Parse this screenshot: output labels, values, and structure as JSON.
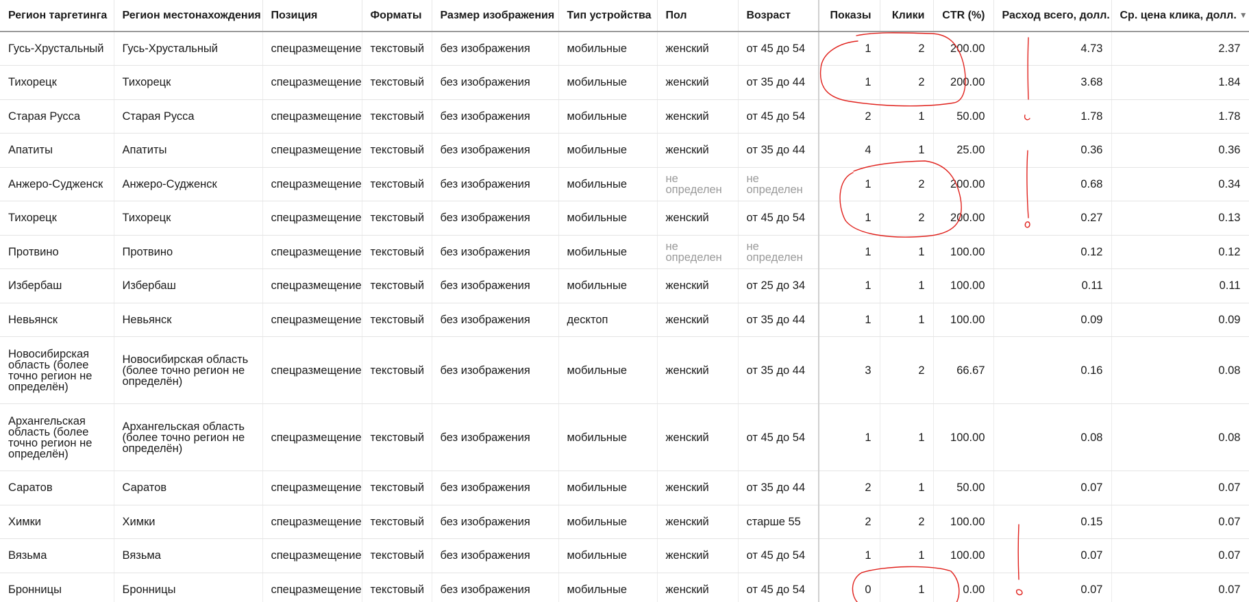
{
  "table": {
    "columns": [
      {
        "key": "target_region",
        "label": "Регион таргетинга",
        "numeric": false
      },
      {
        "key": "location_region",
        "label": "Регион местонахождения",
        "numeric": false
      },
      {
        "key": "position",
        "label": "Позиция",
        "numeric": false
      },
      {
        "key": "format",
        "label": "Форматы",
        "numeric": false
      },
      {
        "key": "image_size",
        "label": "Размер изображения",
        "numeric": false
      },
      {
        "key": "device",
        "label": "Тип устройства",
        "numeric": false
      },
      {
        "key": "gender",
        "label": "Пол",
        "numeric": false
      },
      {
        "key": "age",
        "label": "Возраст",
        "numeric": false
      },
      {
        "key": "impressions",
        "label": "Показы",
        "numeric": true
      },
      {
        "key": "clicks",
        "label": "Клики",
        "numeric": true
      },
      {
        "key": "ctr",
        "label": "CTR (%)",
        "numeric": true
      },
      {
        "key": "spend",
        "label": "Расход всего, долл.",
        "numeric": true
      },
      {
        "key": "cpc",
        "label": "Ср. цена клика, долл.",
        "numeric": true,
        "sorted": "desc",
        "sort_icon": "triangle-down-icon"
      }
    ],
    "rows": [
      {
        "target_region": "Гусь-Хрустальный",
        "location_region": "Гусь-Хрустальный",
        "position": "спецразмещение",
        "format": "текстовый",
        "image_size": "без изображения",
        "device": "мобильные",
        "gender": "женский",
        "age": "от 45 до 54",
        "impressions": "1",
        "clicks": "2",
        "ctr": "200.00",
        "spend": "4.73",
        "cpc": "2.37"
      },
      {
        "target_region": "Тихорецк",
        "location_region": "Тихорецк",
        "position": "спецразмещение",
        "format": "текстовый",
        "image_size": "без изображения",
        "device": "мобильные",
        "gender": "женский",
        "age": "от 35 до 44",
        "impressions": "1",
        "clicks": "2",
        "ctr": "200.00",
        "spend": "3.68",
        "cpc": "1.84"
      },
      {
        "target_region": "Старая Русса",
        "location_region": "Старая Русса",
        "position": "спецразмещение",
        "format": "текстовый",
        "image_size": "без изображения",
        "device": "мобильные",
        "gender": "женский",
        "age": "от 45 до 54",
        "impressions": "2",
        "clicks": "1",
        "ctr": "50.00",
        "spend": "1.78",
        "cpc": "1.78"
      },
      {
        "target_region": "Апатиты",
        "location_region": "Апатиты",
        "position": "спецразмещение",
        "format": "текстовый",
        "image_size": "без изображения",
        "device": "мобильные",
        "gender": "женский",
        "age": "от 35 до 44",
        "impressions": "4",
        "clicks": "1",
        "ctr": "25.00",
        "spend": "0.36",
        "cpc": "0.36"
      },
      {
        "target_region": "Анжеро-Судженск",
        "location_region": "Анжеро-Судженск",
        "position": "спецразмещение",
        "format": "текстовый",
        "image_size": "без изображения",
        "device": "мобильные",
        "gender": "не определен",
        "age": "не определен",
        "impressions": "1",
        "clicks": "2",
        "ctr": "200.00",
        "spend": "0.68",
        "cpc": "0.34",
        "muted": [
          "gender",
          "age"
        ]
      },
      {
        "target_region": "Тихорецк",
        "location_region": "Тихорецк",
        "position": "спецразмещение",
        "format": "текстовый",
        "image_size": "без изображения",
        "device": "мобильные",
        "gender": "женский",
        "age": "от 45 до 54",
        "impressions": "1",
        "clicks": "2",
        "ctr": "200.00",
        "spend": "0.27",
        "cpc": "0.13"
      },
      {
        "target_region": "Протвино",
        "location_region": "Протвино",
        "position": "спецразмещение",
        "format": "текстовый",
        "image_size": "без изображения",
        "device": "мобильные",
        "gender": "не определен",
        "age": "не определен",
        "impressions": "1",
        "clicks": "1",
        "ctr": "100.00",
        "spend": "0.12",
        "cpc": "0.12",
        "muted": [
          "gender",
          "age"
        ]
      },
      {
        "target_region": "Избербаш",
        "location_region": "Избербаш",
        "position": "спецразмещение",
        "format": "текстовый",
        "image_size": "без изображения",
        "device": "мобильные",
        "gender": "женский",
        "age": "от 25 до 34",
        "impressions": "1",
        "clicks": "1",
        "ctr": "100.00",
        "spend": "0.11",
        "cpc": "0.11"
      },
      {
        "target_region": "Невьянск",
        "location_region": "Невьянск",
        "position": "спецразмещение",
        "format": "текстовый",
        "image_size": "без изображения",
        "device": "десктоп",
        "gender": "женский",
        "age": "от 35 до 44",
        "impressions": "1",
        "clicks": "1",
        "ctr": "100.00",
        "spend": "0.09",
        "cpc": "0.09"
      },
      {
        "target_region": "Новосибирская область (более точно регион не определён)",
        "location_region": "Новосибирская область (более точно регион не определён)",
        "position": "спецразмещение",
        "format": "текстовый",
        "image_size": "без изображения",
        "device": "мобильные",
        "gender": "женский",
        "age": "от 35 до 44",
        "impressions": "3",
        "clicks": "2",
        "ctr": "66.67",
        "spend": "0.16",
        "cpc": "0.08",
        "tall": true
      },
      {
        "target_region": "Архангельская область (более точно регион не определён)",
        "location_region": "Архангельская область (более точно регион не определён)",
        "position": "спецразмещение",
        "format": "текстовый",
        "image_size": "без изображения",
        "device": "мобильные",
        "gender": "женский",
        "age": "от 45 до 54",
        "impressions": "1",
        "clicks": "1",
        "ctr": "100.00",
        "spend": "0.08",
        "cpc": "0.08",
        "tall": true
      },
      {
        "target_region": "Саратов",
        "location_region": "Саратов",
        "position": "спецразмещение",
        "format": "текстовый",
        "image_size": "без изображения",
        "device": "мобильные",
        "gender": "женский",
        "age": "от 35 до 44",
        "impressions": "2",
        "clicks": "1",
        "ctr": "50.00",
        "spend": "0.07",
        "cpc": "0.07"
      },
      {
        "target_region": "Химки",
        "location_region": "Химки",
        "position": "спецразмещение",
        "format": "текстовый",
        "image_size": "без изображения",
        "device": "мобильные",
        "gender": "женский",
        "age": "старше 55",
        "impressions": "2",
        "clicks": "2",
        "ctr": "100.00",
        "spend": "0.15",
        "cpc": "0.07"
      },
      {
        "target_region": "Вязьма",
        "location_region": "Вязьма",
        "position": "спецразмещение",
        "format": "текстовый",
        "image_size": "без изображения",
        "device": "мобильные",
        "gender": "женский",
        "age": "от 45 до 54",
        "impressions": "1",
        "clicks": "1",
        "ctr": "100.00",
        "spend": "0.07",
        "cpc": "0.07"
      },
      {
        "target_region": "Бронницы",
        "location_region": "Бронницы",
        "position": "спецразмещение",
        "format": "текстовый",
        "image_size": "без изображения",
        "device": "мобильные",
        "gender": "женский",
        "age": "от 45 до 54",
        "impressions": "0",
        "clicks": "1",
        "ctr": "0.00",
        "spend": "0.07",
        "cpc": "0.07"
      }
    ]
  },
  "annotation": {
    "color": "#e0201b"
  }
}
